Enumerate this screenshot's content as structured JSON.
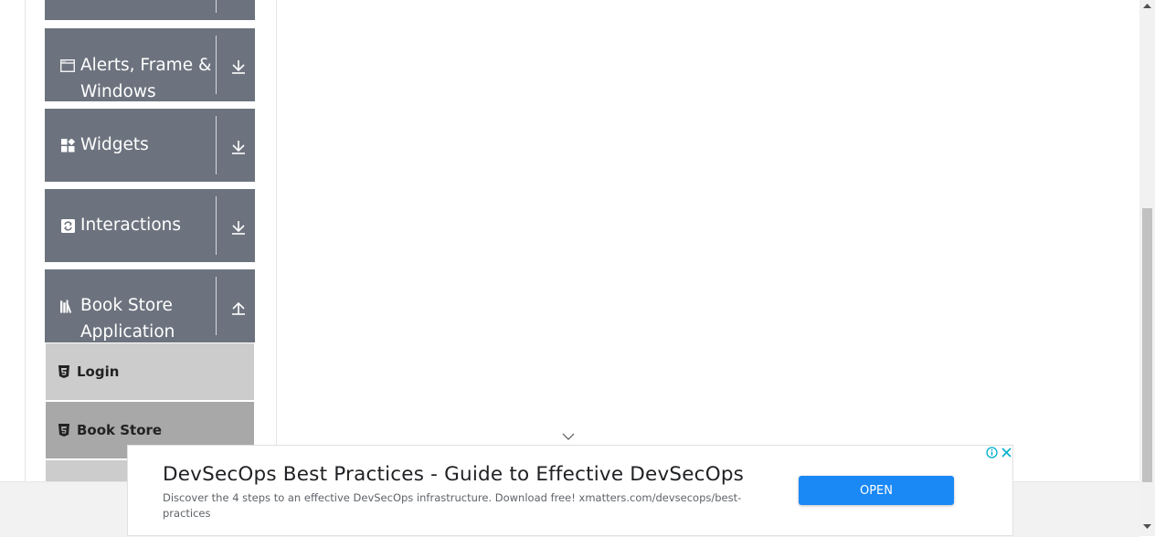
{
  "sidebar": {
    "groups": [
      {
        "label": "",
        "icon": "group-icon",
        "state": "collapsed"
      },
      {
        "label_line1": "Alerts, Frame &",
        "label_line2": "Windows",
        "icon": "window-icon",
        "state": "collapsed"
      },
      {
        "label": "Widgets",
        "icon": "widgets-icon",
        "state": "collapsed"
      },
      {
        "label": "Interactions",
        "icon": "interactions-icon",
        "state": "collapsed"
      },
      {
        "label_line1": "Book Store",
        "label_line2": "Application",
        "icon": "books-icon",
        "state": "expanded"
      }
    ],
    "book_store_items": [
      {
        "label": "Login",
        "icon": "html5-icon"
      },
      {
        "label": "Book Store",
        "icon": "html5-icon",
        "active": true
      },
      {
        "label": "",
        "icon": "html5-icon"
      }
    ]
  },
  "ad": {
    "title": "DevSecOps Best Practices - Guide to Effective DevSecOps",
    "description": "Discover the 4 steps to an effective DevSecOps infrastructure. Download free! xmatters.com/devsecops/best-practices",
    "open_label": "OPEN"
  },
  "colors": {
    "group_bg": "#6c737e",
    "submenu_bg": "#cccccc",
    "submenu_active_bg": "#a8a8a8",
    "ad_button": "#1a88f5"
  }
}
